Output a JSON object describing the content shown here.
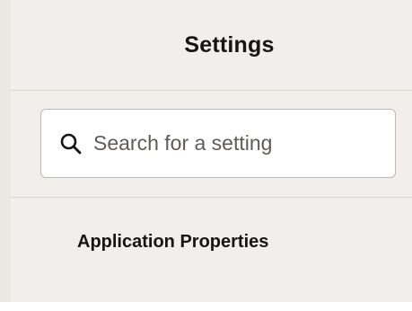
{
  "header": {
    "title": "Settings"
  },
  "search": {
    "placeholder": "Search for a setting",
    "value": "",
    "icon": "search-icon"
  },
  "nav": {
    "items": [
      {
        "label": "Application Properties"
      }
    ]
  }
}
